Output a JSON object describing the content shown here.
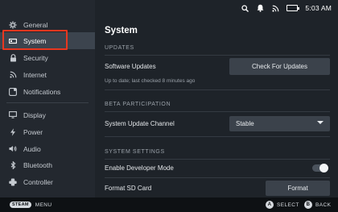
{
  "sidebar": {
    "items": [
      {
        "label": "General",
        "icon": "gear-icon"
      },
      {
        "label": "System",
        "icon": "system-icon"
      },
      {
        "label": "Security",
        "icon": "lock-icon"
      },
      {
        "label": "Internet",
        "icon": "wifi-icon"
      },
      {
        "label": "Notifications",
        "icon": "notifications-icon"
      },
      {
        "label": "Display",
        "icon": "display-icon"
      },
      {
        "label": "Power",
        "icon": "power-icon"
      },
      {
        "label": "Audio",
        "icon": "speaker-icon"
      },
      {
        "label": "Bluetooth",
        "icon": "bluetooth-icon"
      },
      {
        "label": "Controller",
        "icon": "controller-icon"
      }
    ],
    "active": "System"
  },
  "status": {
    "time": "5:03 AM",
    "battery_level": 0.75
  },
  "main": {
    "title": "System",
    "updates": {
      "heading": "UPDATES",
      "label": "Software Updates",
      "button": "Check For Updates",
      "status": "Up to date; last checked 8 minutes ago"
    },
    "beta": {
      "heading": "BETA PARTICIPATION",
      "label": "System Update Channel",
      "selected": "Stable"
    },
    "settings": {
      "heading": "SYSTEM SETTINGS",
      "dev_mode_label": "Enable Developer Mode",
      "dev_mode_enabled": false,
      "format_label": "Format SD Card",
      "format_button": "Format"
    }
  },
  "bottom": {
    "steam": "STEAM",
    "menu": "MENU",
    "a_key": "A",
    "select": "SELECT",
    "b_key": "B",
    "back": "BACK"
  },
  "colors": {
    "highlight": "#e8371f",
    "background": "#1e2329",
    "sidebar": "#23282f",
    "button": "#3b424b"
  }
}
